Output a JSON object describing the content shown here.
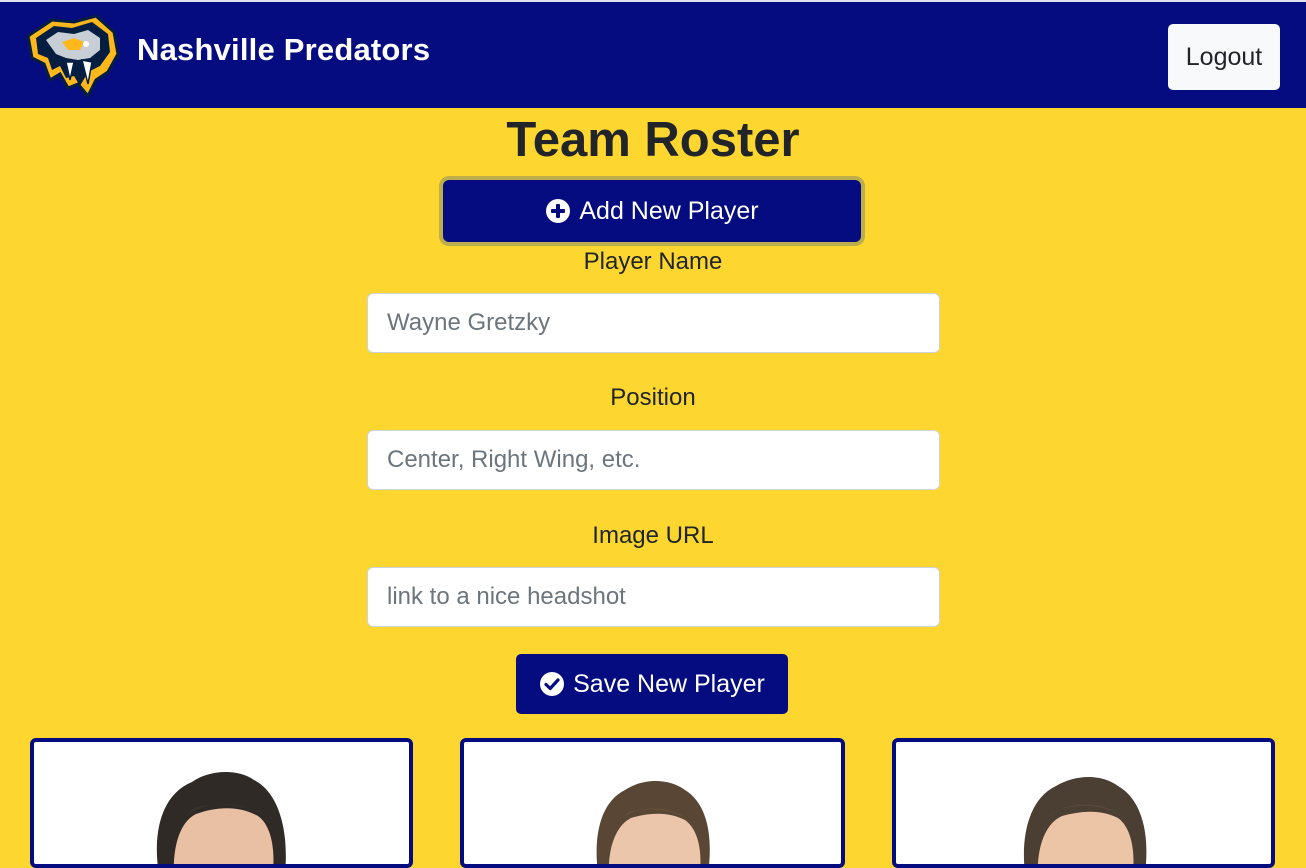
{
  "navbar": {
    "brand_name": "Nashville Predators",
    "logo_icon": "predators-logo-icon",
    "logout_label": "Logout",
    "background_color": "#040c7f"
  },
  "main": {
    "title": "Team Roster",
    "add_player_label": "Add New Player",
    "add_player_icon": "plus-circle-icon",
    "background_color": "#fdd730"
  },
  "form": {
    "player_name": {
      "label": "Player Name",
      "placeholder": "Wayne Gretzky",
      "value": ""
    },
    "position": {
      "label": "Position",
      "placeholder": "Center, Right Wing, etc.",
      "value": ""
    },
    "image_url": {
      "label": "Image URL",
      "placeholder": "link to a nice headshot",
      "value": ""
    },
    "save_label": "Save New Player",
    "save_icon": "check-circle-icon"
  },
  "roster": {
    "cards": [
      {
        "image": "player-headshot"
      },
      {
        "image": "player-headshot"
      },
      {
        "image": "player-headshot"
      }
    ]
  }
}
